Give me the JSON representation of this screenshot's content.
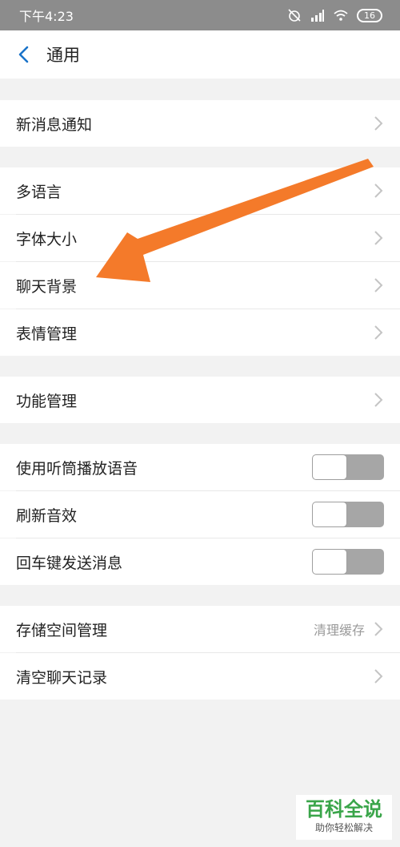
{
  "status_bar": {
    "time": "下午4:23",
    "battery": "16"
  },
  "header": {
    "title": "通用"
  },
  "sections": {
    "notify": {
      "label": "新消息通知"
    },
    "general": [
      {
        "label": "多语言"
      },
      {
        "label": "字体大小"
      },
      {
        "label": "聊天背景"
      },
      {
        "label": "表情管理"
      }
    ],
    "feature": {
      "label": "功能管理"
    },
    "toggles": [
      {
        "label": "使用听筒播放语音",
        "on": false
      },
      {
        "label": "刷新音效",
        "on": false
      },
      {
        "label": "回车键发送消息",
        "on": false
      }
    ],
    "storage": {
      "label": "存储空间管理",
      "sub": "清理缓存"
    },
    "clear": {
      "label": "清空聊天记录"
    }
  },
  "watermark": {
    "title": "百科全说",
    "subtitle": "助你轻松解决"
  },
  "colors": {
    "arrow": "#f47a2a",
    "toggle_off": "#a6a6a6",
    "back": "#1a73c9"
  }
}
